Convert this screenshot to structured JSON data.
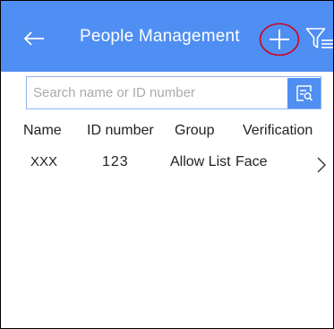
{
  "header": {
    "title": "People Management",
    "back_icon": "arrow-left-icon",
    "add_icon": "plus-icon",
    "filter_icon": "filter-icon",
    "background_color": "#4f8ef2",
    "annotation_color": "#d0021b"
  },
  "search": {
    "placeholder": "Search name or ID number",
    "value": "",
    "button_icon": "search-list-icon"
  },
  "table": {
    "columns": [
      "Name",
      "ID number",
      "Group",
      "Verification"
    ],
    "rows": [
      {
        "name": "XXX",
        "id_number": "123",
        "group": "Allow List",
        "verification": "Face"
      }
    ]
  }
}
